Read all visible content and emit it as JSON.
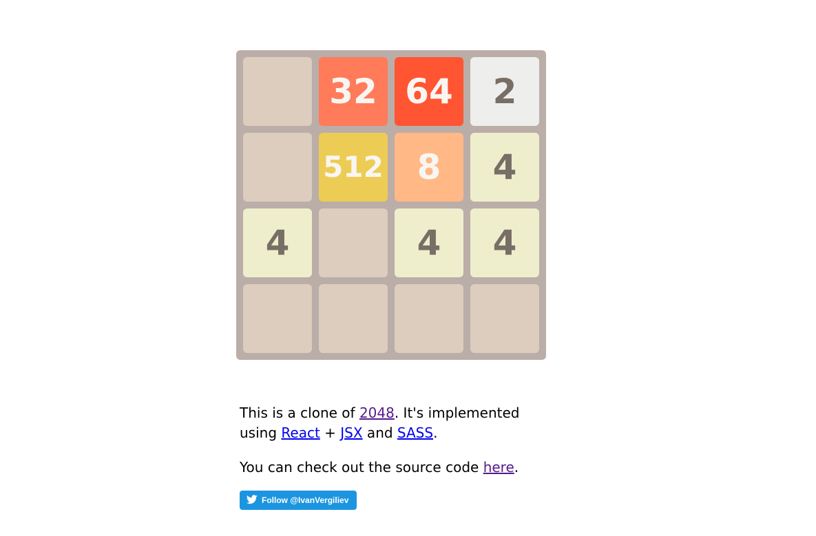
{
  "board": {
    "background": "#bbada8",
    "empty_cell_color": "#ddcdbe",
    "tiles": [
      {
        "row": 0,
        "col": 0,
        "value": ""
      },
      {
        "row": 0,
        "col": 1,
        "value": "32"
      },
      {
        "row": 0,
        "col": 2,
        "value": "64"
      },
      {
        "row": 0,
        "col": 3,
        "value": "2"
      },
      {
        "row": 1,
        "col": 0,
        "value": ""
      },
      {
        "row": 1,
        "col": 1,
        "value": "512"
      },
      {
        "row": 1,
        "col": 2,
        "value": "8"
      },
      {
        "row": 1,
        "col": 3,
        "value": "4"
      },
      {
        "row": 2,
        "col": 0,
        "value": "4"
      },
      {
        "row": 2,
        "col": 1,
        "value": ""
      },
      {
        "row": 2,
        "col": 2,
        "value": "4"
      },
      {
        "row": 2,
        "col": 3,
        "value": "4"
      },
      {
        "row": 3,
        "col": 0,
        "value": ""
      },
      {
        "row": 3,
        "col": 1,
        "value": ""
      },
      {
        "row": 3,
        "col": 2,
        "value": ""
      },
      {
        "row": 3,
        "col": 3,
        "value": ""
      }
    ],
    "tile_styles": {
      "2": {
        "bg": "#eeeeec",
        "fg": "#776e65"
      },
      "4": {
        "bg": "#eeeecc",
        "fg": "#776e65"
      },
      "8": {
        "bg": "#ffb886",
        "fg": "#f9f6f2"
      },
      "32": {
        "bg": "#ff7b5a",
        "fg": "#f9f6f2"
      },
      "64": {
        "bg": "#ff5533",
        "fg": "#f9f6f2"
      },
      "512": {
        "bg": "#edcc55",
        "fg": "#f9f6f2"
      }
    }
  },
  "info": {
    "line1_prefix": "This is a clone of ",
    "link_2048": "2048",
    "line1_middle": ". It's implemented using ",
    "link_react": "React",
    "plus": " + ",
    "link_jsx": "JSX",
    "and": " and ",
    "link_sass": "SASS",
    "period1": ".",
    "line2_prefix": "You can check out the source code ",
    "link_here": "here",
    "period2": "."
  },
  "follow_button": {
    "label": "Follow @IvanVergiliev",
    "icon": "twitter-bird-icon",
    "color": "#1b95e0"
  }
}
